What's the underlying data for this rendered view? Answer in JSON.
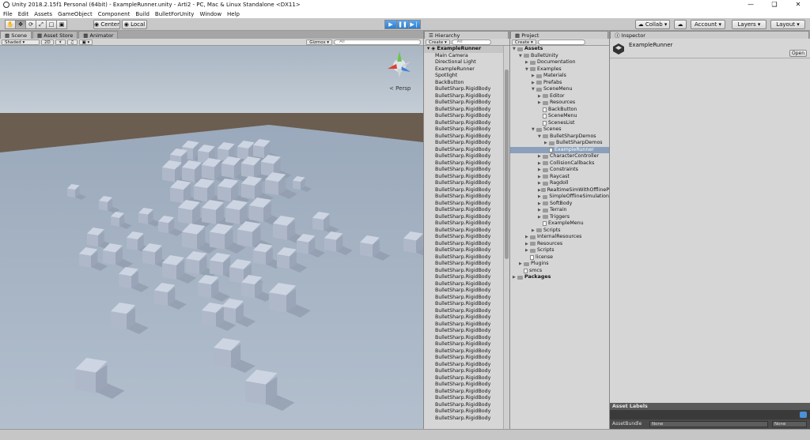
{
  "window": {
    "title": "Unity 2018.2.15f1 Personal (64bit) - ExampleRunner.unity - Arti2 - PC, Mac & Linux Standalone <DX11>"
  },
  "menu": [
    "File",
    "Edit",
    "Assets",
    "GameObject",
    "Component",
    "Build",
    "BulletForUnity",
    "Window",
    "Help"
  ],
  "toolbar": {
    "pivot_label": "Center",
    "space_label": "Local",
    "collab_label": "Collab",
    "account_label": "Account",
    "layers_label": "Layers",
    "layout_label": "Layout"
  },
  "scene_tabs": [
    "Scene",
    "Asset Store",
    "Animator"
  ],
  "scene_bar": {
    "shading": "Shaded",
    "mode2d": "2D",
    "gizmos": "Gizmos",
    "search_placeholder": "All"
  },
  "scene_view": {
    "persp_label": "Persp"
  },
  "hierarchy": {
    "tab": "Hierarchy",
    "create_label": "Create",
    "search_placeholder": "All",
    "root": "ExampleRunner",
    "items": [
      "Main Camera",
      "Directional Light",
      "ExampleRunner",
      "Spotlight",
      "BackButton",
      "BulletSharp.RigidBody",
      "BulletSharp.RigidBody",
      "BulletSharp.RigidBody",
      "BulletSharp.RigidBody",
      "BulletSharp.RigidBody",
      "BulletSharp.RigidBody",
      "BulletSharp.RigidBody",
      "BulletSharp.RigidBody",
      "BulletSharp.RigidBody",
      "BulletSharp.RigidBody",
      "BulletSharp.RigidBody",
      "BulletSharp.RigidBody",
      "BulletSharp.RigidBody",
      "BulletSharp.RigidBody",
      "BulletSharp.RigidBody",
      "BulletSharp.RigidBody",
      "BulletSharp.RigidBody",
      "BulletSharp.RigidBody",
      "BulletSharp.RigidBody",
      "BulletSharp.RigidBody",
      "BulletSharp.RigidBody",
      "BulletSharp.RigidBody",
      "BulletSharp.RigidBody",
      "BulletSharp.RigidBody",
      "BulletSharp.RigidBody",
      "BulletSharp.RigidBody",
      "BulletSharp.RigidBody",
      "BulletSharp.RigidBody",
      "BulletSharp.RigidBody",
      "BulletSharp.RigidBody",
      "BulletSharp.RigidBody",
      "BulletSharp.RigidBody",
      "BulletSharp.RigidBody",
      "BulletSharp.RigidBody",
      "BulletSharp.RigidBody",
      "BulletSharp.RigidBody",
      "BulletSharp.RigidBody",
      "BulletSharp.RigidBody",
      "BulletSharp.RigidBody",
      "BulletSharp.RigidBody",
      "BulletSharp.RigidBody",
      "BulletSharp.RigidBody",
      "BulletSharp.RigidBody",
      "BulletSharp.RigidBody",
      "BulletSharp.RigidBody",
      "BulletSharp.RigidBody",
      "BulletSharp.RigidBody",
      "BulletSharp.RigidBody",
      "BulletSharp.RigidBody",
      "BulletSharp.RigidBody"
    ]
  },
  "project": {
    "tab": "Project",
    "create_label": "Create",
    "items": [
      {
        "label": "Assets",
        "level": 0,
        "kind": "folder",
        "open": true,
        "bold": true
      },
      {
        "label": "BulletUnity",
        "level": 1,
        "kind": "folder",
        "open": true
      },
      {
        "label": "Documentation",
        "level": 2,
        "kind": "folder"
      },
      {
        "label": "Examples",
        "level": 2,
        "kind": "folder",
        "open": true
      },
      {
        "label": "Materials",
        "level": 3,
        "kind": "folder"
      },
      {
        "label": "Prefabs",
        "level": 3,
        "kind": "folder"
      },
      {
        "label": "SceneMenu",
        "level": 3,
        "kind": "folder",
        "open": true
      },
      {
        "label": "Editor",
        "level": 4,
        "kind": "folder"
      },
      {
        "label": "Resources",
        "level": 4,
        "kind": "folder"
      },
      {
        "label": "BackButton",
        "level": 4,
        "kind": "file"
      },
      {
        "label": "SceneMenu",
        "level": 4,
        "kind": "file"
      },
      {
        "label": "ScenesList",
        "level": 4,
        "kind": "file"
      },
      {
        "label": "Scenes",
        "level": 3,
        "kind": "folder",
        "open": true
      },
      {
        "label": "BulletSharpDemos",
        "level": 4,
        "kind": "folder",
        "open": true
      },
      {
        "label": "BulletSharpDemos",
        "level": 5,
        "kind": "folder"
      },
      {
        "label": "ExampleRunner",
        "level": 5,
        "kind": "file",
        "selected": true
      },
      {
        "label": "CharacterController",
        "level": 4,
        "kind": "folder"
      },
      {
        "label": "CollisionCallbacks",
        "level": 4,
        "kind": "folder"
      },
      {
        "label": "Constraints",
        "level": 4,
        "kind": "folder"
      },
      {
        "label": "Raycast",
        "level": 4,
        "kind": "folder"
      },
      {
        "label": "Ragdoll",
        "level": 4,
        "kind": "folder"
      },
      {
        "label": "RealtimeSimWithOfflineP",
        "level": 4,
        "kind": "folder"
      },
      {
        "label": "SimpleOfflineSimulation",
        "level": 4,
        "kind": "folder"
      },
      {
        "label": "SoftBody",
        "level": 4,
        "kind": "folder"
      },
      {
        "label": "Terrain",
        "level": 4,
        "kind": "folder"
      },
      {
        "label": "Triggers",
        "level": 4,
        "kind": "folder"
      },
      {
        "label": "ExampleMenu",
        "level": 4,
        "kind": "file"
      },
      {
        "label": "Scripts",
        "level": 3,
        "kind": "folder"
      },
      {
        "label": "InternalResources",
        "level": 2,
        "kind": "folder"
      },
      {
        "label": "Resources",
        "level": 2,
        "kind": "folder"
      },
      {
        "label": "Scripts",
        "level": 2,
        "kind": "folder"
      },
      {
        "label": "license",
        "level": 2,
        "kind": "file"
      },
      {
        "label": "Plugins",
        "level": 1,
        "kind": "folder"
      },
      {
        "label": "smcs",
        "level": 1,
        "kind": "file"
      },
      {
        "label": "Packages",
        "level": 0,
        "kind": "folder",
        "bold": true
      }
    ]
  },
  "inspector": {
    "tab": "Inspector",
    "object_name": "ExampleRunner",
    "open_label": "Open",
    "asset_labels": "Asset Labels",
    "asset_bundle_label": "AssetBundle",
    "asset_bundle_value": "None",
    "asset_bundle_variant": "None"
  },
  "colors": {
    "play_blue": "#2b7fd1",
    "selection": "#8aa0bc",
    "sky": "#b4c2d0",
    "ground": "#6b5d50",
    "cube": "#b8c2d4"
  }
}
